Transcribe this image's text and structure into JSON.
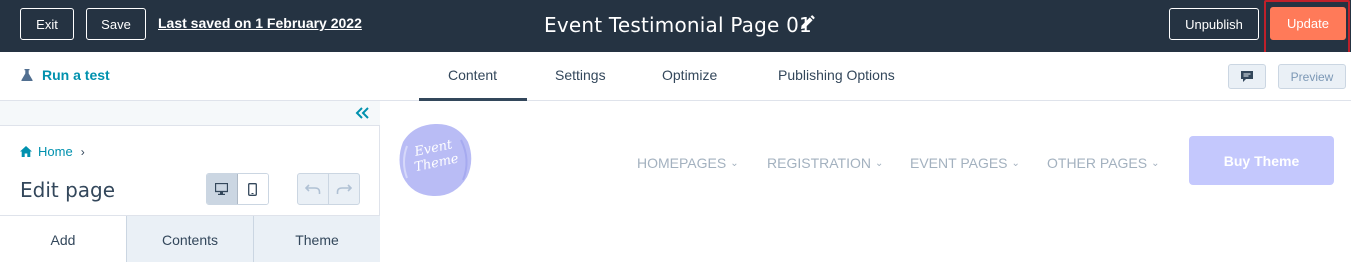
{
  "topbar": {
    "exit_label": "Exit",
    "save_label": "Save",
    "last_saved": "Last saved on 1 February 2022",
    "page_title": "Event Testimonial Page 01",
    "unpublish_label": "Unpublish",
    "update_label": "Update"
  },
  "navbar": {
    "run_test": "Run a test",
    "tabs": [
      {
        "label": "Content"
      },
      {
        "label": "Settings"
      },
      {
        "label": "Optimize"
      },
      {
        "label": "Publishing Options"
      }
    ],
    "active_tab": "Content",
    "preview_label": "Preview"
  },
  "sidebar": {
    "breadcrumb": "Home",
    "title": "Edit page",
    "tabs": [
      {
        "label": "Add"
      },
      {
        "label": "Contents"
      },
      {
        "label": "Theme"
      }
    ],
    "active_tab": "Add"
  },
  "site_preview": {
    "logo_line1": "Event",
    "logo_line2": "Theme",
    "nav_items": [
      {
        "label": "HOMEPAGES"
      },
      {
        "label": "REGISTRATION"
      },
      {
        "label": "EVENT PAGES"
      },
      {
        "label": "OTHER PAGES"
      }
    ],
    "cta_label": "Buy Theme"
  },
  "colors": {
    "topbar_bg": "#253342",
    "update_accent": "#ff7a59",
    "highlight_box": "#c0202a",
    "link": "#0091ae",
    "cta_bg": "#c4c8fd",
    "logo_bg": "#b9bcf5"
  },
  "icons": {
    "pencil": "pencil-icon",
    "flask": "flask-icon",
    "comment": "comment-icon",
    "collapse": "double-chevron-left-icon",
    "home": "home-icon",
    "desktop": "desktop-icon",
    "mobile": "mobile-icon",
    "undo": "undo-icon",
    "redo": "redo-icon"
  }
}
